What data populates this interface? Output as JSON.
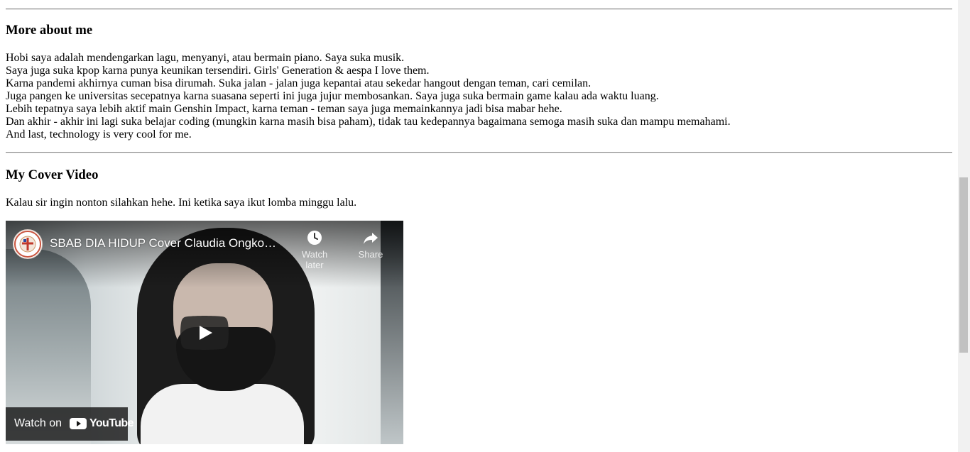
{
  "more_about": {
    "heading": "More about me",
    "lines": [
      "Hobi saya adalah mendengarkan lagu, menyanyi, atau bermain piano. Saya suka musik.",
      "Saya juga suka kpop karna punya keunikan tersendiri. Girls' Generation & aespa I love them.",
      "Karna pandemi akhirnya cuman bisa dirumah. Suka jalan - jalan juga kepantai atau sekedar hangout dengan teman, cari cemilan.",
      "Juga pangen ke universitas secepatnya karna suasana seperti ini juga jujur membosankan. Saya juga suka bermain game kalau ada waktu luang.",
      "Lebih tepatnya saya lebih aktif main Genshin Impact, karna teman - teman saya juga memainkannya jadi bisa mabar hehe.",
      "Dan akhir - akhir ini lagi suka belajar coding (mungkin karna masih bisa paham), tidak tau kedepannya bagaimana semoga masih suka dan mampu memahami.",
      "And last, technology is very cool for me."
    ]
  },
  "cover": {
    "heading": "My Cover Video",
    "text": "Kalau sir ingin nonton silahkan hehe. Ini ketika saya ikut lomba minggu lalu."
  },
  "video": {
    "title": "SBAB DIA HIDUP Cover Claudia Ongko…",
    "watch_later": "Watch later",
    "share": "Share",
    "watch_on": "Watch on",
    "youtube": "YouTube",
    "icons": {
      "channel": "channel-logo-icon",
      "clock": "clock-icon",
      "share": "share-arrow-icon",
      "play": "play-icon",
      "youtube": "youtube-logo-icon"
    },
    "colors": {
      "play_bg": "#212121",
      "youtube_red": "#ff0000"
    }
  }
}
